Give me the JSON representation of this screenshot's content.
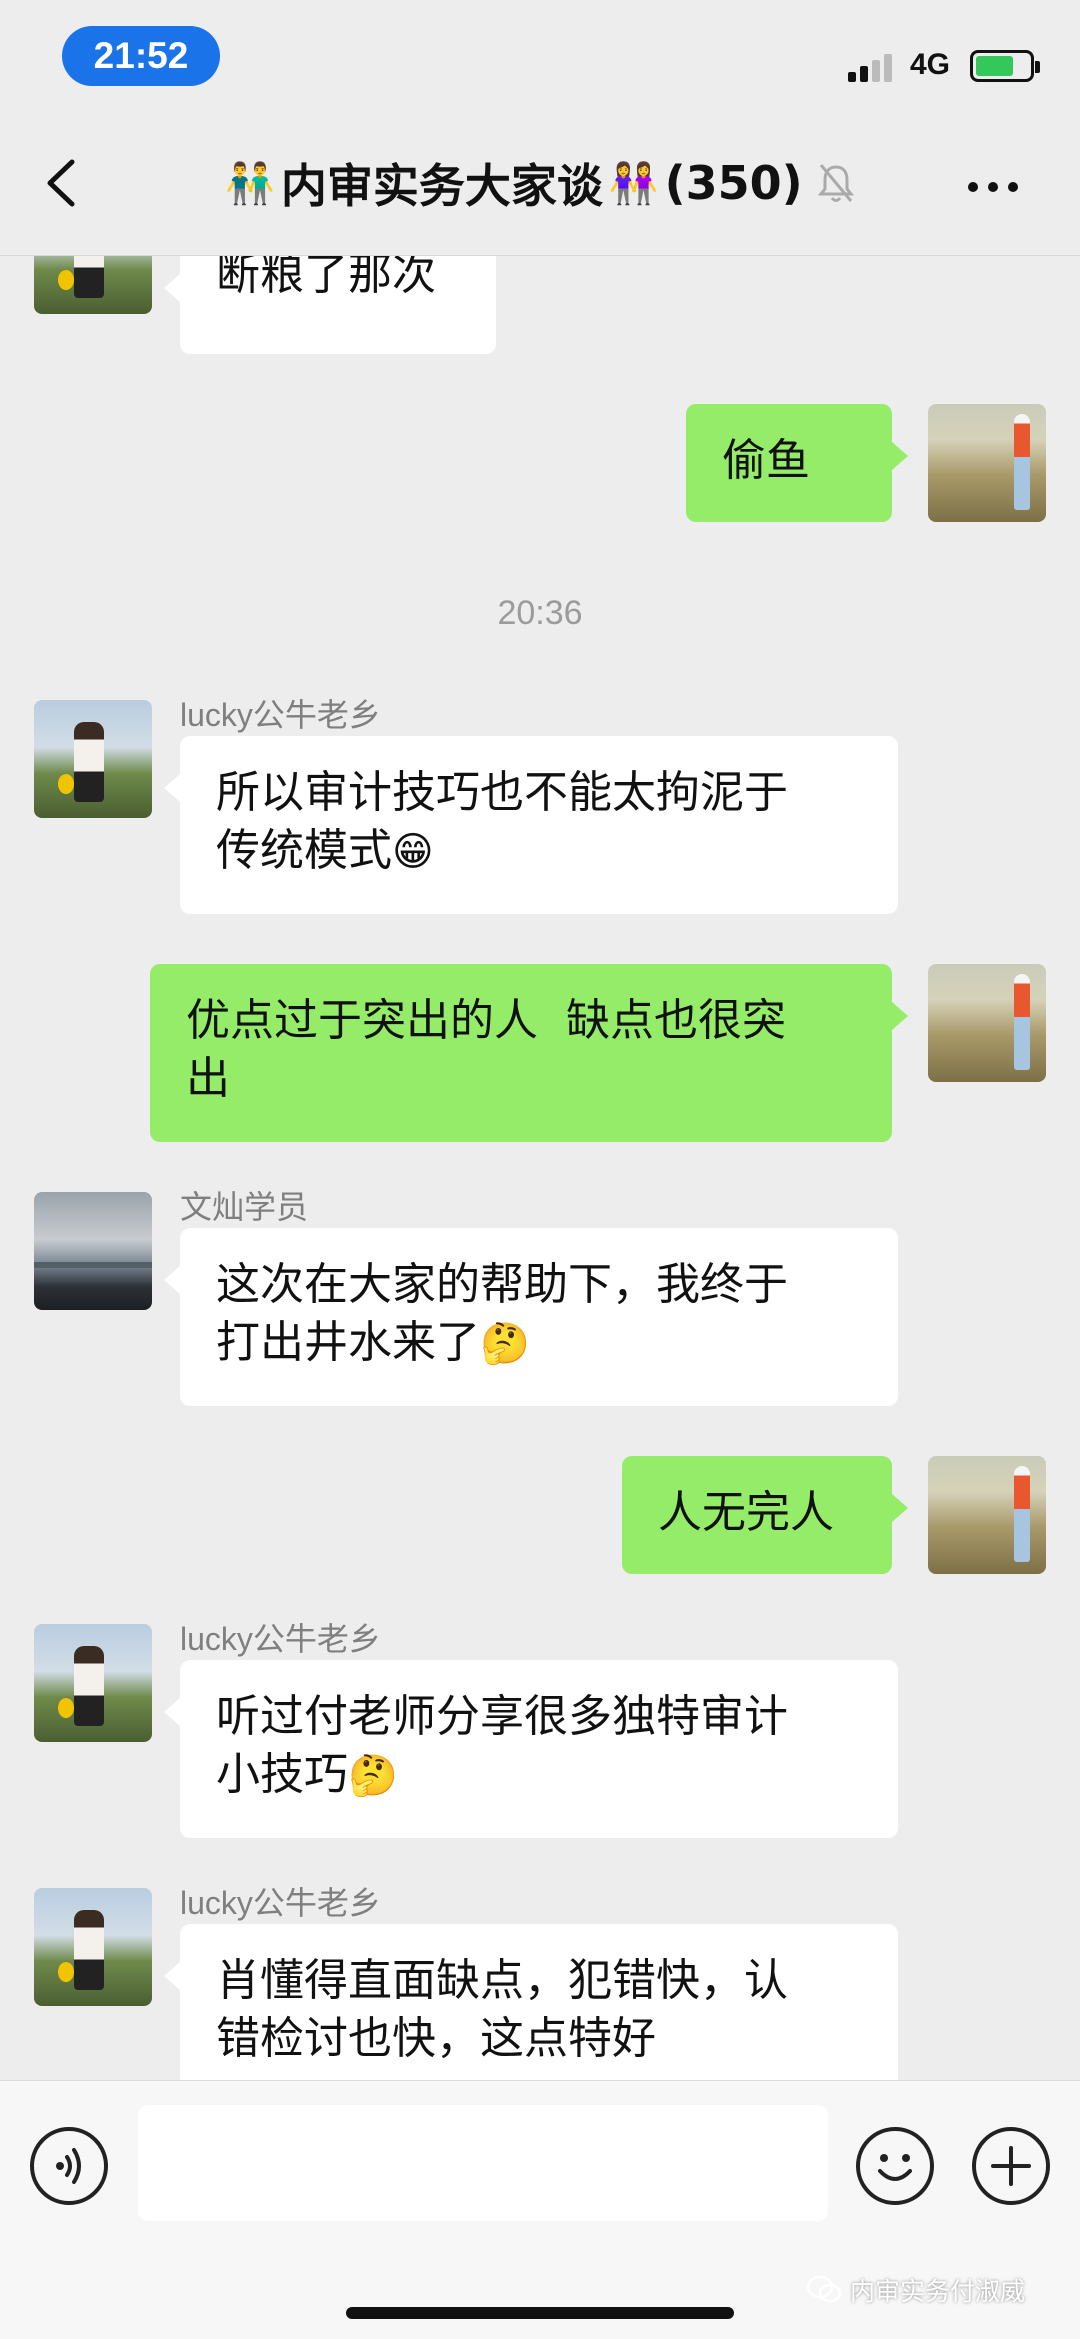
{
  "status_bar": {
    "time": "21:52",
    "network": "4G",
    "battery_level": 0.72,
    "time_pill_color": "#1a73e8",
    "battery_color": "#34c759"
  },
  "nav": {
    "back_icon": "chevron-left-icon",
    "emoji_left": "👬",
    "title": "内审实务大家谈",
    "emoji_right": "👭",
    "member_count": "(350)",
    "mute_icon": "bell-slash-icon",
    "more_icon": "ellipsis-icon"
  },
  "messages": [
    {
      "direction": "in",
      "sender": "",
      "avatar": "girl-on-rock",
      "text": "断粮了那次"
    },
    {
      "direction": "out",
      "avatar": "woman-in-field",
      "text": "偷鱼"
    },
    {
      "type": "timestamp",
      "text": "20:36"
    },
    {
      "direction": "in",
      "sender": "lucky公牛老乡",
      "avatar": "girl-on-rock",
      "line1": "所以审计技巧也不能太拘泥于",
      "line2": "传统模式",
      "emoji": "😁"
    },
    {
      "direction": "out",
      "avatar": "woman-in-field",
      "line1": "优点过于突出的人  缺点也很突",
      "line2": "出"
    },
    {
      "direction": "in",
      "sender": "文灿学员",
      "avatar": "cloudy-sky",
      "line1": "这次在大家的帮助下，我终于",
      "line2": "打出井水来了",
      "emoji": "🤔"
    },
    {
      "direction": "out",
      "avatar": "woman-in-field",
      "text": "人无完人"
    },
    {
      "direction": "in",
      "sender": "lucky公牛老乡",
      "avatar": "girl-on-rock",
      "line1": "听过付老师分享很多独特审计",
      "line2": "小技巧",
      "emoji": "🤔"
    },
    {
      "direction": "in",
      "sender": "lucky公牛老乡",
      "avatar": "girl-on-rock",
      "line1": "肖懂得直面缺点，犯错快，认",
      "line2": "错检讨也快，这点特好"
    }
  ],
  "colors": {
    "background": "#ededed",
    "bubble_in": "#ffffff",
    "bubble_out": "#95ec69",
    "sender_text": "#7f7f7f"
  },
  "input_bar": {
    "voice_icon": "voice-wave-icon",
    "emoji_icon": "smiley-icon",
    "plus_icon": "plus-icon",
    "input_value": ""
  },
  "watermark": {
    "icon": "wechat-logo-icon",
    "text": "内审实务付淑威"
  }
}
